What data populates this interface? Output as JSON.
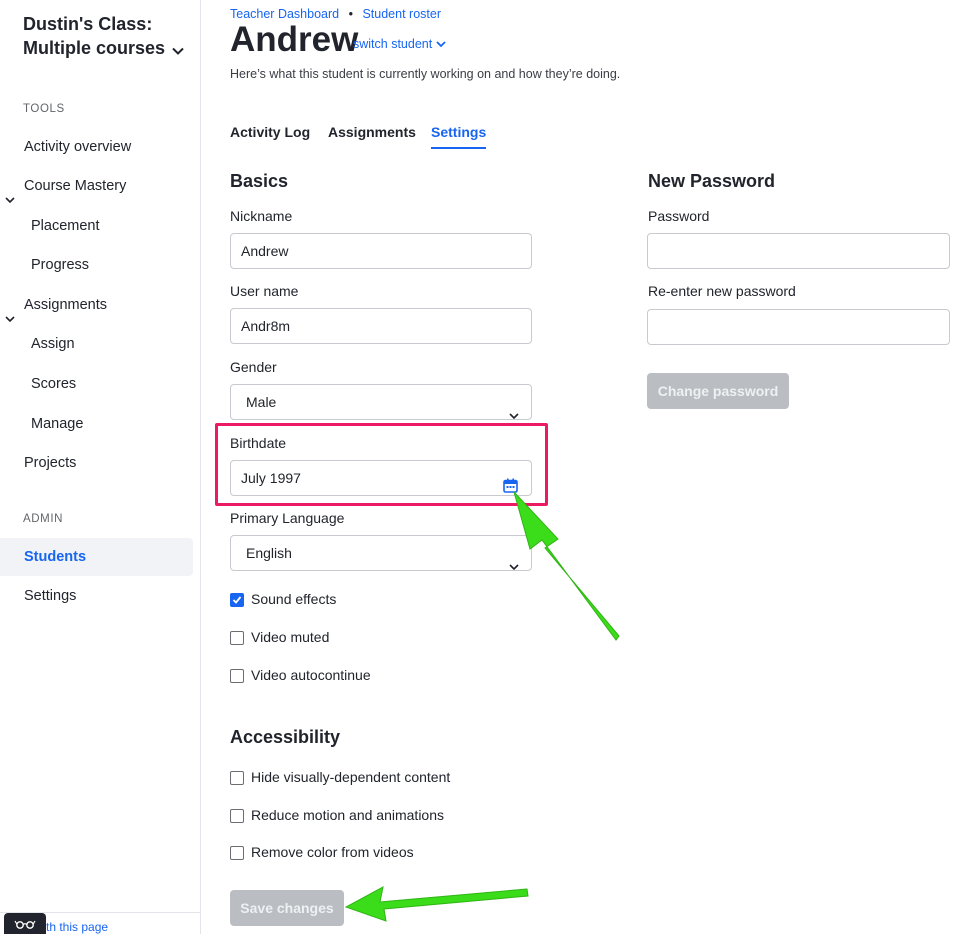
{
  "sidebar": {
    "class_title": "Dustin's Class: Multiple courses",
    "sections": {
      "tools": "TOOLS",
      "admin": "ADMIN"
    },
    "items": [
      {
        "label": "Activity overview"
      },
      {
        "label": "Course Mastery"
      },
      {
        "label": "Placement"
      },
      {
        "label": "Progress"
      },
      {
        "label": "Assignments"
      },
      {
        "label": "Assign"
      },
      {
        "label": "Scores"
      },
      {
        "label": "Manage"
      },
      {
        "label": "Projects"
      },
      {
        "label": "Students"
      },
      {
        "label": "Settings"
      }
    ],
    "footer_link": "th this page"
  },
  "header": {
    "breadcrumb": [
      "Teacher Dashboard",
      "Student roster"
    ],
    "breadcrumb_sep": "•",
    "student_name": "Andrew",
    "switch_label": "switch student",
    "subtitle": "Here’s what this student is currently working on and how they’re doing."
  },
  "tabs": [
    {
      "label": "Activity Log"
    },
    {
      "label": "Assignments"
    },
    {
      "label": "Settings",
      "active": true
    }
  ],
  "basics": {
    "heading": "Basics",
    "nickname_label": "Nickname",
    "nickname_value": "Andrew",
    "username_label": "User name",
    "username_value": "Andr8m",
    "gender_label": "Gender",
    "gender_value": "Male",
    "birthdate_label": "Birthdate",
    "birthdate_value": "July 1997",
    "language_label": "Primary Language",
    "language_value": "English",
    "options": [
      {
        "label": "Sound effects",
        "checked": true
      },
      {
        "label": "Video muted",
        "checked": false
      },
      {
        "label": "Video autocontinue",
        "checked": false
      }
    ]
  },
  "accessibility": {
    "heading": "Accessibility",
    "options": [
      {
        "label": "Hide visually-dependent content",
        "checked": false
      },
      {
        "label": "Reduce motion and animations",
        "checked": false
      },
      {
        "label": "Remove color from videos",
        "checked": false
      }
    ],
    "save_label": "Save changes"
  },
  "password": {
    "heading": "New Password",
    "password_label": "Password",
    "password_value": "",
    "reenter_label": "Re-enter new password",
    "reenter_value": "",
    "change_label": "Change password"
  },
  "colors": {
    "accent": "#1865f2",
    "highlight": "#ec1a64",
    "annotation_arrow": "#3bdc1a",
    "disabled_button": "#babec2"
  }
}
